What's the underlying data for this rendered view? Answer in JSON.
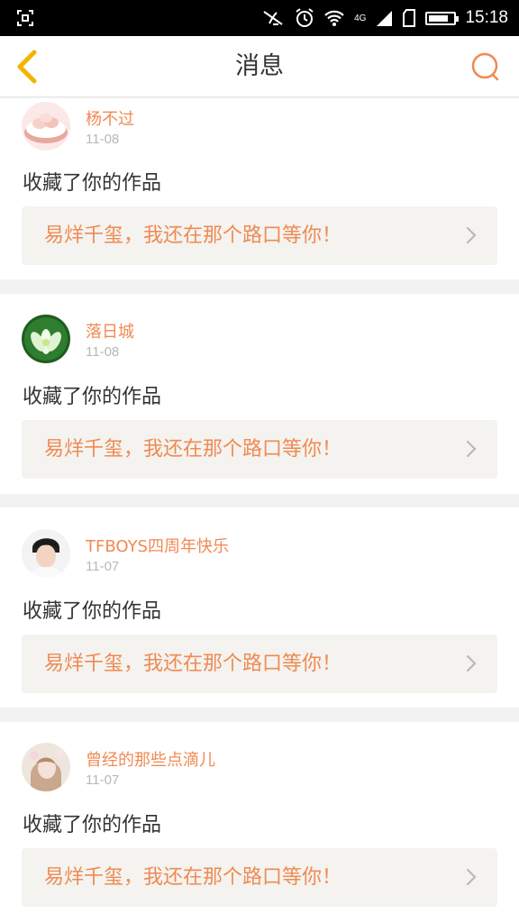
{
  "status_bar": {
    "time": "15:18",
    "network": "4G",
    "battery_level": 0.8
  },
  "header": {
    "title": "消息"
  },
  "colors": {
    "accent": "#f08a53",
    "work_bg": "#f4f3ef",
    "back_arrow": "#f4b400"
  },
  "messages": [
    {
      "user": "杨不过",
      "date": "11-08",
      "action": "收藏了你的作品",
      "work": "易烊千玺，我还在那个路口等你！",
      "avatar": "dumpling-avatar"
    },
    {
      "user": "落日城",
      "date": "11-08",
      "action": "收藏了你的作品",
      "work": "易烊千玺，我还在那个路口等你！",
      "avatar": "lotus-avatar"
    },
    {
      "user": "TFBOYS四周年快乐",
      "date": "11-07",
      "action": "收藏了你的作品",
      "work": "易烊千玺，我还在那个路口等你！",
      "avatar": "boy-portrait-avatar"
    },
    {
      "user": "曾经的那些点滴儿",
      "date": "11-07",
      "action": "收藏了你的作品",
      "work": "易烊千玺，我还在那个路口等你！",
      "avatar": "girl-portrait-avatar"
    }
  ]
}
